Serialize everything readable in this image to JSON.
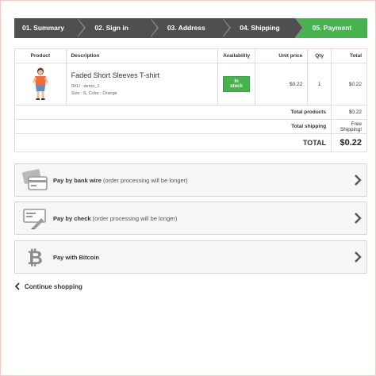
{
  "steps": [
    {
      "label": "01. Summary"
    },
    {
      "label": "02. Sign in"
    },
    {
      "label": "03. Address"
    },
    {
      "label": "04. Shipping"
    },
    {
      "label": "05. Payment"
    }
  ],
  "table": {
    "headers": {
      "product": "Product",
      "description": "Description",
      "availability": "Availability",
      "unit_price": "Unit price",
      "qty": "Qty",
      "total": "Total"
    },
    "item": {
      "name": "Faded Short Sleeves T-shirt",
      "sku": "SKU : demo_1",
      "size_color": "Size : S, Color : Orange",
      "availability": "In stock",
      "unit_price": "$0.22",
      "qty": "1",
      "total": "$0.22"
    },
    "summary": {
      "total_products_label": "Total products",
      "total_products_value": "$0.22",
      "total_shipping_label": "Total shipping",
      "total_shipping_value": "Free Shipping!",
      "total_label": "TOTAL",
      "total_value": "$0.22"
    }
  },
  "payments": [
    {
      "title": "Pay by bank wire",
      "note": "(order processing will be longer)",
      "icon": "bank-card-icon"
    },
    {
      "title": "Pay by check",
      "note": "(order processing will be longer)",
      "icon": "check-icon"
    },
    {
      "title": "Pay with Bitcoin",
      "note": "",
      "icon": "bitcoin-icon"
    }
  ],
  "continue_label": "Continue shopping",
  "colors": {
    "step_dark": "#4f4f4f",
    "step_active": "#46b34c",
    "in_stock": "#46b34c"
  }
}
